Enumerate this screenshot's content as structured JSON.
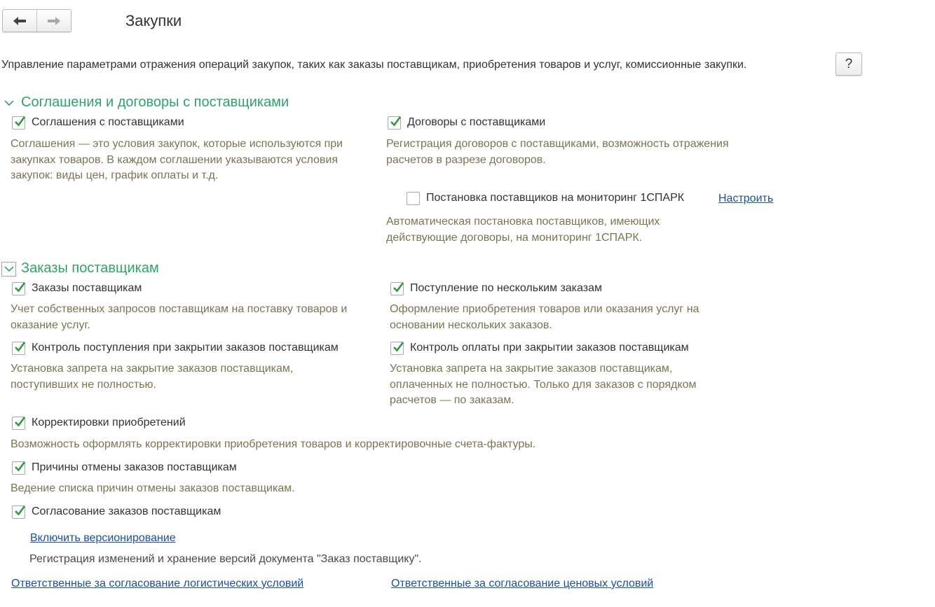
{
  "window": {
    "title": "Закупки"
  },
  "nav": {
    "back_icon": "arrow-left",
    "forward_icon": "arrow-right"
  },
  "intro": "Управление параметрами отражения операций закупок, таких как заказы поставщикам, приобретения товаров и услуг, комиссионные закупки.",
  "help": {
    "label": "?"
  },
  "colors": {
    "accent_green": "#2ea36a",
    "description": "#7b7452",
    "link": "#1a4fa3",
    "check": "#2d9a44"
  },
  "section1": {
    "title": "Соглашения и договоры с поставщиками",
    "agreements": {
      "label": "Соглашения с поставщиками",
      "checked": true,
      "desc": "Соглашения — это условия закупок, которые используются при закупках товаров. В каждом соглашении указываются условия закупок: виды цен, график оплаты и т.д."
    },
    "contracts": {
      "label": "Договоры с поставщиками",
      "checked": true,
      "desc": "Регистрация договоров с поставщиками, возможность отражения расчетов в разрезе договоров."
    },
    "monitoring": {
      "label": "Постановка поставщиков на мониторинг 1СПАРК",
      "checked": false,
      "link": "Настроить",
      "desc": "Автоматическая постановка поставщиков, имеющих действующие договоры, на мониторинг 1СПАРК."
    }
  },
  "section2": {
    "title": "Заказы поставщикам",
    "orders": {
      "label": "Заказы поставщикам",
      "checked": true,
      "desc": "Учет собственных запросов поставщикам на поставку товаров и оказание услуг."
    },
    "multi_receipt": {
      "label": "Поступление по нескольким заказам",
      "checked": true,
      "desc": "Оформление приобретения товаров или оказания услуг на основании нескольких заказов."
    },
    "receipt_control": {
      "label": "Контроль поступления при закрытии заказов поставщикам",
      "checked": true,
      "desc": "Установка запрета на закрытие заказов поставщикам, поступивших не полностью."
    },
    "payment_control": {
      "label": "Контроль оплаты при закрытии заказов поставщикам",
      "checked": true,
      "desc": "Установка запрета на закрытие заказов поставщикам, оплаченных не полностью. Только для заказов с порядком расчетов — по заказам."
    },
    "adjustments": {
      "label": "Корректировки приобретений",
      "checked": true,
      "desc": "Возможность оформлять корректировки приобретения товаров и корректировочные счета-фактуры."
    },
    "cancel_reasons": {
      "label": "Причины отмены заказов поставщикам",
      "checked": true,
      "desc": "Ведение списка причин отмены заказов поставщикам."
    },
    "approval": {
      "label": "Согласование заказов поставщикам",
      "checked": true,
      "versioning_link": "Включить версионирование",
      "versioning_desc": "Регистрация изменений и хранение версий документа \"Заказ поставщику\"."
    },
    "logistics_link": "Ответственные за согласование логистических условий",
    "price_link": "Ответственные за согласование ценовых условий"
  }
}
